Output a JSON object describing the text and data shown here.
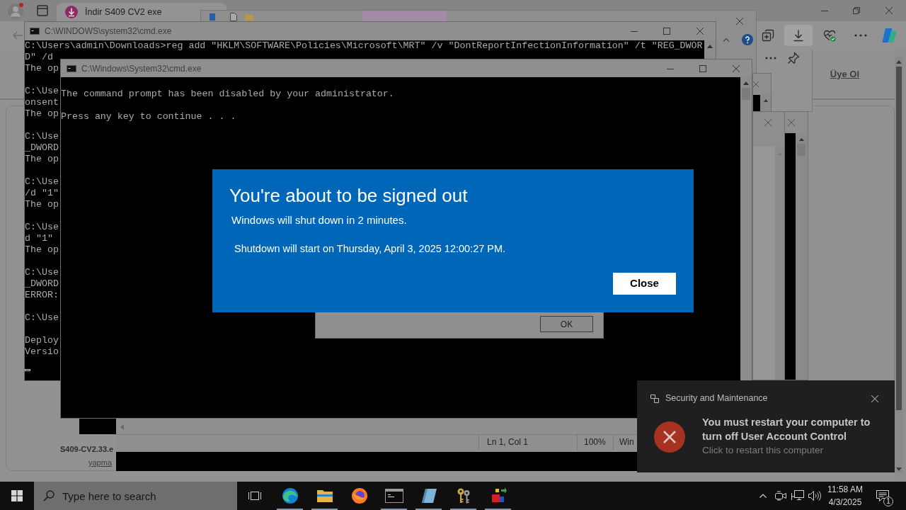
{
  "browser": {
    "tab_title": "İndir S409 CV2 exe",
    "downloads_active": true,
    "page_link": "Üye Ol",
    "file_name": "S409-CV2.33.e",
    "file_link": "yapma"
  },
  "cmd_windows": [
    {
      "title": "C:\\WINDOWS\\system32\\cmd.exe",
      "blocks": [
        [
          "C:\\Users\\admin\\Downloads>reg add \"HKLM\\SOFTWARE\\Policies\\Microsoft\\MRT\" /v \"DontReportInfectionInformation\" /t \"REG_DWOR",
          "D\" /d",
          "The op"
        ],
        [
          "C:\\Use",
          "onsent",
          "The op"
        ],
        [
          "C:\\Use",
          "_DWORD",
          "The op"
        ],
        [
          "C:\\Use",
          "/d \"1\"",
          "The op"
        ],
        [
          "C:\\Use",
          "d \"1\"",
          "The op"
        ],
        [
          "C:\\Use",
          "_DWORD",
          "ERROR:"
        ],
        [
          "C:\\Use"
        ],
        [
          "Deploy",
          "Versio"
        ]
      ],
      "cursor": true
    },
    {
      "title": "C:\\Windows\\System32\\cmd.exe",
      "blocks": [
        [
          "The command prompt has been disabled by your administrator."
        ],
        [
          "Press any key to continue . . ."
        ]
      ]
    }
  ],
  "notepad": {
    "status": [
      "Ln 1, Col 1",
      "100%",
      "Win"
    ]
  },
  "message_box": {
    "button": "OK"
  },
  "dialog": {
    "title": "You're about to be signed out",
    "message": "Windows will shut down in 2 minutes.",
    "detail": "Shutdown will start on Thursday, April 3, 2025 12:00:27 PM.",
    "button": "Close"
  },
  "notification": {
    "app": "Security and Maintenance",
    "title": "You must restart your computer to turn off User Account Control",
    "body": "Click to restart this computer"
  },
  "taskbar": {
    "search_placeholder": "Type here to search",
    "apps": [
      {
        "kind": "edge",
        "running": true
      },
      {
        "kind": "explorer",
        "running": true
      },
      {
        "kind": "firefox",
        "running": false
      },
      {
        "kind": "terminal",
        "running": true
      },
      {
        "kind": "tile",
        "running": true
      },
      {
        "kind": "keys",
        "running": true
      },
      {
        "kind": "setup",
        "running": true
      }
    ],
    "time": "11:58 AM",
    "date": "4/3/2025",
    "notification_count": "1"
  }
}
